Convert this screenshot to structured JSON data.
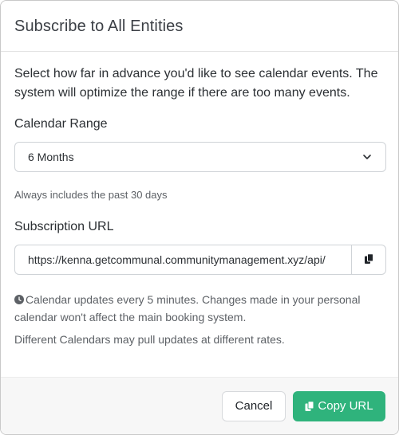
{
  "dialog": {
    "title": "Subscribe to All Entities",
    "intro": "Select how far in advance you'd like to see calendar events. The system will optimize the range if there are too many events."
  },
  "calendar_range": {
    "label": "Calendar Range",
    "selected": "6 Months",
    "help": "Always includes the past 30 days"
  },
  "subscription": {
    "label": "Subscription URL",
    "url": "https://kenna.getcommunal.communitymanagement.xyz/api/"
  },
  "notes": {
    "update_note": "Calendar updates every 5 minutes. Changes made in your personal calendar won't affect the main booking system.",
    "rates_note": "Different Calendars may pull updates at different rates."
  },
  "footer": {
    "cancel_label": "Cancel",
    "copy_label": "Copy URL"
  },
  "colors": {
    "primary": "#2fb37c",
    "text": "#2b2f33",
    "muted": "#5d6166"
  },
  "icons": {
    "select": "chevron-down-icon",
    "copy_field": "copy-icon",
    "note": "clock-icon",
    "copy_button": "copy-icon"
  }
}
